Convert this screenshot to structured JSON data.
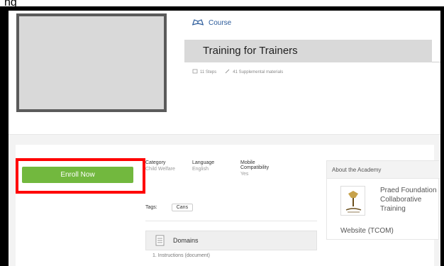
{
  "header": {
    "course_type": "Course",
    "title": "Training for Trainers",
    "meta": {
      "steps": "11 Steps",
      "supplemental": "41 Supplemental materials"
    }
  },
  "enroll": {
    "label": "Enroll Now"
  },
  "info": {
    "category_label": "Category",
    "category_value": "Child Welfare",
    "language_label": "Language",
    "language_value": "English",
    "mobile_label": "Mobile Compatibility",
    "mobile_value": "Yes"
  },
  "tags": {
    "label": "Tags:",
    "items": [
      "Cans"
    ]
  },
  "domains": {
    "label": "Domains",
    "first_item": "1.    Instructions (document)"
  },
  "about": {
    "title": "About the Academy",
    "org_name": "Praed Foundation Collaborative Training",
    "org_name_line2": "Website (TCOM)"
  },
  "colors": {
    "accent": "#2a5a9a",
    "enroll": "#72b83e",
    "highlight": "#ff0000"
  }
}
